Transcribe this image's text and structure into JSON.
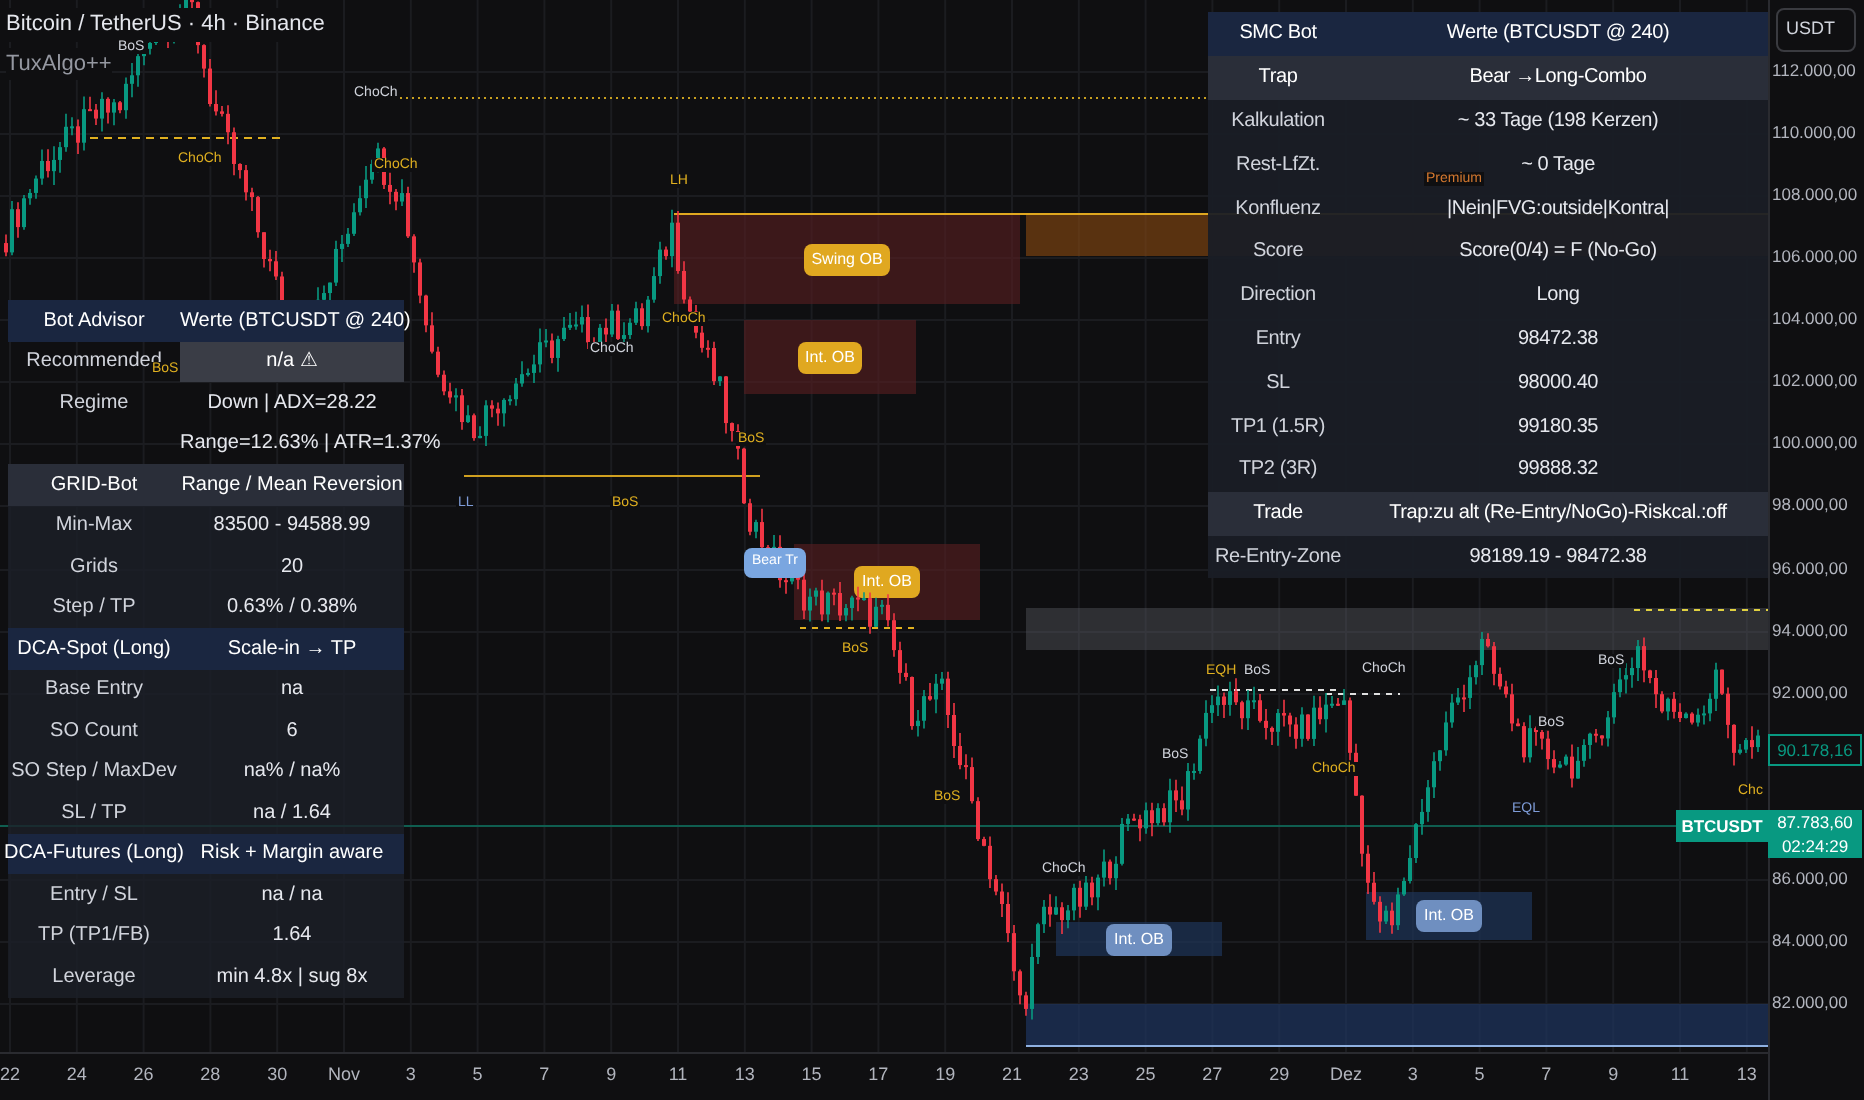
{
  "header": {
    "symbol": "Bitcoin / TetherUS · 4h · Binance",
    "indicator": "TuxAlgo++"
  },
  "currency_button": "USDT",
  "price_axis": [
    "112.000,00",
    "110.000,00",
    "108.000,00",
    "106.000,00",
    "104.000,00",
    "102.000,00",
    "100.000,00",
    "98.000,00",
    "96.000,00",
    "94.000,00",
    "92.000,00",
    "86.000,00",
    "84.000,00",
    "82.000,00"
  ],
  "time_axis": [
    "22",
    "24",
    "26",
    "28",
    "30",
    "Nov",
    "3",
    "5",
    "7",
    "9",
    "11",
    "13",
    "15",
    "17",
    "19",
    "21",
    "23",
    "25",
    "27",
    "29",
    "Dez",
    "3",
    "5",
    "7",
    "9",
    "11",
    "13"
  ],
  "price_tags": [
    {
      "kind": "last",
      "text": "90.178,16"
    },
    {
      "kind": "symbol",
      "text": "BTCUSDT"
    },
    {
      "kind": "current",
      "text": "87.783,60"
    },
    {
      "kind": "countdown",
      "text": "02:24:29"
    }
  ],
  "zones": [
    {
      "kind": "bear",
      "label": "Swing OB"
    },
    {
      "kind": "bear",
      "label": "Int. OB"
    },
    {
      "kind": "bear",
      "label": "Int. OB"
    },
    {
      "kind": "bull",
      "label": "Int. OB"
    },
    {
      "kind": "bull",
      "label": "Int. OB"
    }
  ],
  "trap_marker": "Bear Tr",
  "structure_labels": [
    {
      "text": "BoS",
      "color": "#d1d4dc"
    },
    {
      "text": "ChoCh",
      "color": "#e0b020"
    },
    {
      "text": "ChoCh",
      "color": "#d1d4dc"
    },
    {
      "text": "ChoCh",
      "color": "#e0b020"
    },
    {
      "text": "LH",
      "color": "#e0b020"
    },
    {
      "text": "ChoCh",
      "color": "#d1d4dc"
    },
    {
      "text": "ChoCh",
      "color": "#e0b020"
    },
    {
      "text": "BoS",
      "color": "#e0b020"
    },
    {
      "text": "LL",
      "color": "#7e9cd8"
    },
    {
      "text": "BoS",
      "color": "#e0b020"
    },
    {
      "text": "BoS",
      "color": "#e0b020"
    },
    {
      "text": "BoS",
      "color": "#e0b020"
    },
    {
      "text": "BoS",
      "color": "#d1d4dc"
    },
    {
      "text": "ChoCh",
      "color": "#d1d4dc"
    },
    {
      "text": "EQH",
      "color": "#e0b020"
    },
    {
      "text": "BoS",
      "color": "#d1d4dc"
    },
    {
      "text": "ChoCh",
      "color": "#d1d4dc"
    },
    {
      "text": "ChoCh",
      "color": "#e0b020"
    },
    {
      "text": "BoS",
      "color": "#d1d4dc"
    },
    {
      "text": "BoS",
      "color": "#d1d4dc"
    },
    {
      "text": "EQL",
      "color": "#7e9cd8"
    },
    {
      "text": "Chc",
      "color": "#e0b020"
    },
    {
      "text": "Premium",
      "color": "#d4782f"
    },
    {
      "text": "BoS",
      "color": "#e0b020"
    }
  ],
  "bot_advisor": {
    "rows": [
      {
        "kind": "header",
        "label": "Bot Advisor",
        "value": "Werte (BTCUSDT @ 240)"
      },
      {
        "kind": "flag",
        "label": "Recommended",
        "value": "n/a ⚠"
      },
      {
        "kind": "plain",
        "label": "Regime",
        "value": "Down | ADX=28.22"
      },
      {
        "kind": "plain",
        "value": "Range=12.63% | ATR=1.37%"
      },
      {
        "kind": "section",
        "label": "GRID-Bot",
        "value": "Range / Mean Reversion"
      },
      {
        "kind": "row",
        "label": "Min-Max",
        "value": "83500 - 94588.99"
      },
      {
        "kind": "row",
        "label": "Grids",
        "value": "20"
      },
      {
        "kind": "row",
        "label": "Step / TP",
        "value": "0.63% / 0.38%"
      },
      {
        "kind": "header",
        "label": "DCA-Spot (Long)",
        "value": "Scale-in → TP"
      },
      {
        "kind": "row",
        "label": "Base Entry",
        "value": "na"
      },
      {
        "kind": "row",
        "label": "SO Count",
        "value": "6"
      },
      {
        "kind": "row",
        "label": "SO Step / MaxDev",
        "value": "na% / na%"
      },
      {
        "kind": "row",
        "label": "SL / TP",
        "value": "na / 1.64"
      },
      {
        "kind": "header",
        "label": "DCA-Futures (Long)",
        "value": "Risk + Margin aware"
      },
      {
        "kind": "row",
        "label": "Entry / SL",
        "value": "na / na"
      },
      {
        "kind": "row",
        "label": "TP (TP1/FB)",
        "value": "1.64"
      },
      {
        "kind": "row",
        "label": "Leverage",
        "value": "min 4.8x | sug 8x"
      }
    ]
  },
  "smc_bot": {
    "rows": [
      {
        "kind": "header",
        "label": "SMC Bot",
        "value": "Werte (BTCUSDT @ 240)"
      },
      {
        "kind": "section",
        "label": "Trap",
        "value": "Bear →Long-Combo"
      },
      {
        "kind": "row",
        "label": "Kalkulation",
        "value": "~ 33 Tage (198 Kerzen)"
      },
      {
        "kind": "row",
        "label": "Rest-LfZt.",
        "value": "~ 0 Tage"
      },
      {
        "kind": "row",
        "label": "Konfluenz",
        "value": "|Nein|FVG:outside|Kontra|"
      },
      {
        "kind": "row",
        "label": "Score",
        "value": "Score(0/4) = F (No-Go)"
      },
      {
        "kind": "row",
        "label": "Direction",
        "value": "Long"
      },
      {
        "kind": "row",
        "label": "Entry",
        "value": "98472.38"
      },
      {
        "kind": "row",
        "label": "SL",
        "value": "98000.40"
      },
      {
        "kind": "row",
        "label": "TP1 (1.5R)",
        "value": "99180.35"
      },
      {
        "kind": "row",
        "label": "TP2 (3R)",
        "value": "99888.32"
      },
      {
        "kind": "section",
        "label": "Trade",
        "value": "Trap:zu alt (Re-Entry/NoGo)-Riskcal.:off"
      },
      {
        "kind": "row",
        "label": "Re-Entry-Zone",
        "value": "98189.19 - 98472.38"
      }
    ]
  }
}
